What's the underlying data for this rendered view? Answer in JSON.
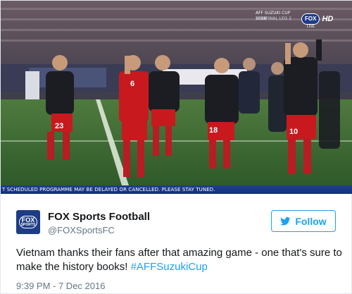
{
  "media": {
    "ticker_text": "T SCHEDULED PROGRAMME MAY BE DELAYED OR CANCELLED. PLEASE STAY TUNED.",
    "scorebug_line1": "AFF SUZUKI CUP 2016",
    "scorebug_line2": "SEMIFINAL LEG 2",
    "network_logo": "FOX",
    "network_hd": "HD",
    "network_live": "LIVE",
    "jersey_numbers": [
      "23",
      "6",
      "18",
      "10"
    ],
    "colors": {
      "jersey_red": "#c8191e",
      "jacket": "#1b1d22",
      "pitch": "#3f6b34",
      "ticker": "#1f3f8f"
    }
  },
  "tweet": {
    "author_name": "FOX Sports Football",
    "author_handle": "@FOXSportsFC",
    "avatar_text": "FOX",
    "avatar_subtext": "SPORTS",
    "follow_label": "Follow",
    "text_before": "Vietnam thanks their fans after that amazing game - one that's sure to make the history books! ",
    "hashtag": "#AFFSuzukiCup",
    "timestamp": "9:39 PM - 7 Dec 2016",
    "colors": {
      "link": "#1da1f2",
      "secondary": "#657786",
      "avatar_bg": "#1d3c86"
    }
  }
}
